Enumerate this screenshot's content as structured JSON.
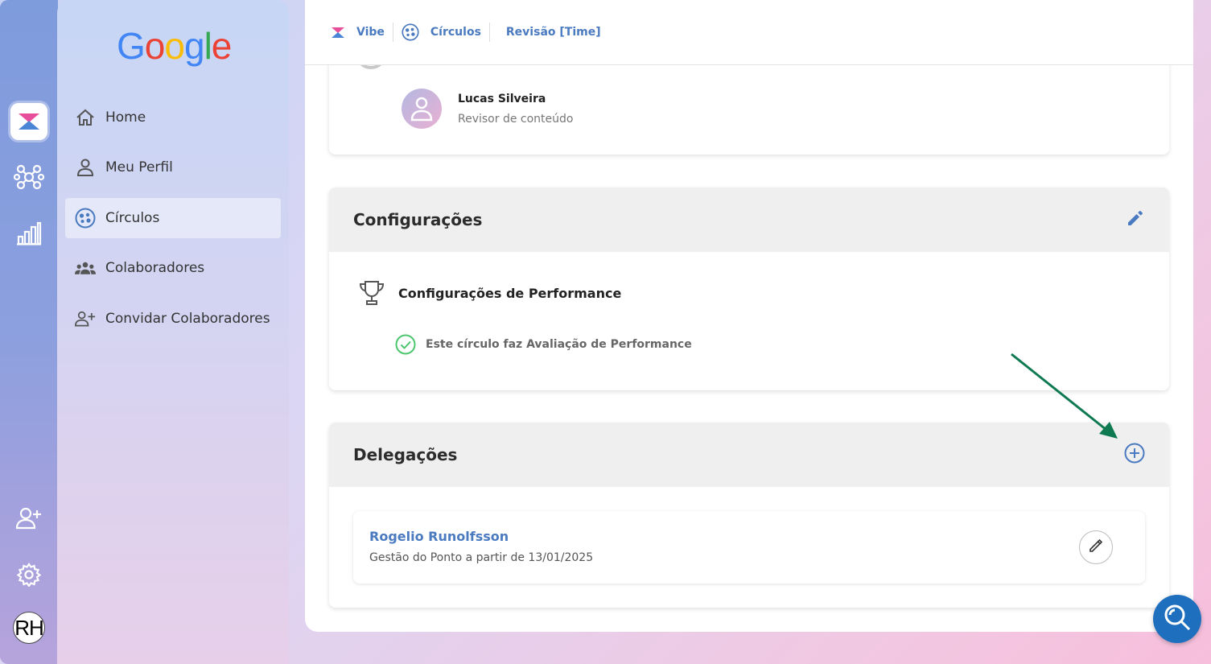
{
  "colors": {
    "accent": "#4a7ac0",
    "fab": "#1f6fbf",
    "arrow": "#0f7a52",
    "check": "#4cc76e"
  },
  "rail": {
    "icons": [
      "vibe-logo-icon",
      "network-icon",
      "bar-chart-icon",
      "add-user-icon",
      "gear-icon"
    ],
    "avatar_initials": "RH"
  },
  "sidebar": {
    "logo": "Google",
    "items": [
      {
        "label": "Home",
        "icon": "home-icon"
      },
      {
        "label": "Meu Perfil",
        "icon": "user-icon"
      },
      {
        "label": "Círculos",
        "icon": "circles-icon",
        "active": true
      },
      {
        "label": "Colaboradores",
        "icon": "people-icon"
      },
      {
        "label": "Convidar Colaboradores",
        "icon": "invite-user-icon"
      }
    ]
  },
  "breadcrumb": {
    "items": [
      "Vibe",
      "Círculos",
      "Revisão [Time]"
    ]
  },
  "member": {
    "name": "Lucas Silveira",
    "role": "Revisor de conteúdo"
  },
  "settings": {
    "title": "Configurações",
    "performance_title": "Configurações de Performance",
    "performance_check": "Este círculo faz Avaliação de Performance"
  },
  "delegations": {
    "title": "Delegações",
    "items": [
      {
        "name": "Rogelio Runolfsson",
        "description": "Gestão do Ponto a partir de 13/01/2025"
      }
    ]
  }
}
